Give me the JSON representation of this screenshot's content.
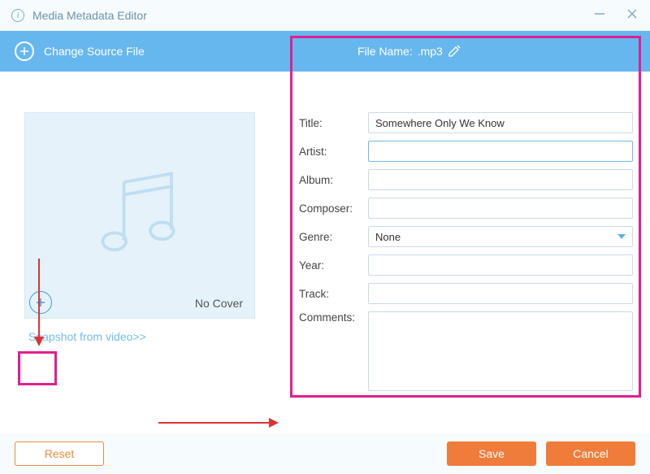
{
  "window": {
    "title": "Media Metadata Editor"
  },
  "toolbar": {
    "change_source": "Change Source File",
    "file_name_label": "File Name:",
    "file_name_value": ".mp3"
  },
  "cover": {
    "no_cover": "No Cover",
    "snapshot_link": "Snapshot from video>>"
  },
  "form": {
    "title": {
      "label": "Title:",
      "value": "Somewhere Only We Know"
    },
    "artist": {
      "label": "Artist:",
      "value": ""
    },
    "album": {
      "label": "Album:",
      "value": ""
    },
    "composer": {
      "label": "Composer:",
      "value": ""
    },
    "genre": {
      "label": "Genre:",
      "value": "None"
    },
    "year": {
      "label": "Year:",
      "value": ""
    },
    "track": {
      "label": "Track:",
      "value": ""
    },
    "comments": {
      "label": "Comments:",
      "value": ""
    }
  },
  "footer": {
    "reset": "Reset",
    "save": "Save",
    "cancel": "Cancel"
  },
  "colors": {
    "accent_blue": "#67b7ef",
    "accent_orange": "#f07c3b",
    "annotation_pink": "#e11f8f"
  }
}
